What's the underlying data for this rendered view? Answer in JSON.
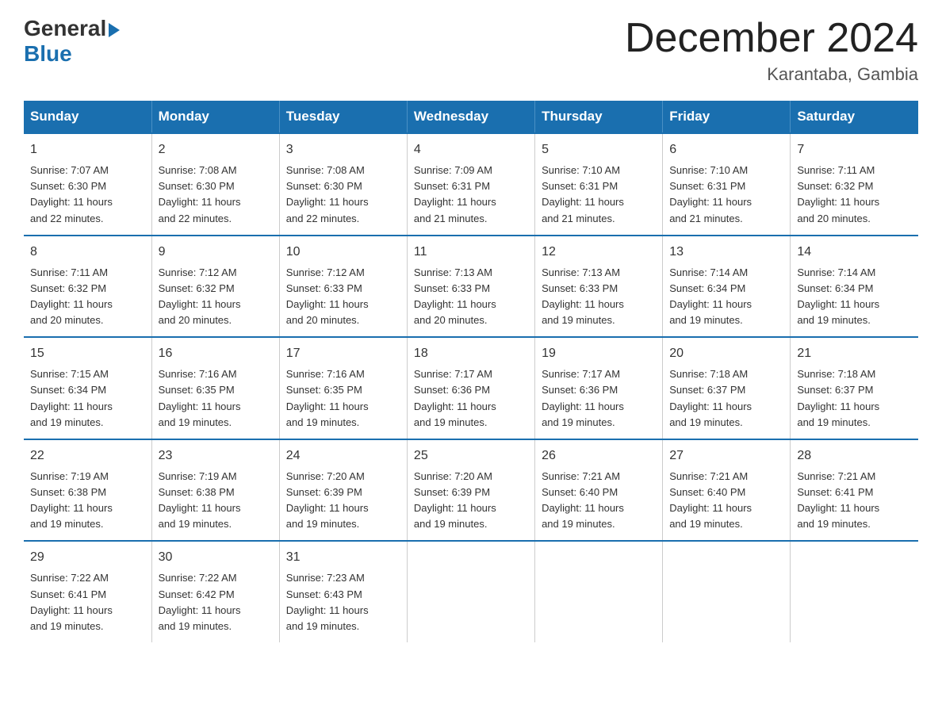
{
  "logo": {
    "general": "General",
    "blue": "Blue"
  },
  "title": {
    "month_year": "December 2024",
    "location": "Karantaba, Gambia"
  },
  "days_header": [
    "Sunday",
    "Monday",
    "Tuesday",
    "Wednesday",
    "Thursday",
    "Friday",
    "Saturday"
  ],
  "weeks": [
    [
      {
        "day": "1",
        "sunrise": "7:07 AM",
        "sunset": "6:30 PM",
        "daylight": "11 hours and 22 minutes."
      },
      {
        "day": "2",
        "sunrise": "7:08 AM",
        "sunset": "6:30 PM",
        "daylight": "11 hours and 22 minutes."
      },
      {
        "day": "3",
        "sunrise": "7:08 AM",
        "sunset": "6:30 PM",
        "daylight": "11 hours and 22 minutes."
      },
      {
        "day": "4",
        "sunrise": "7:09 AM",
        "sunset": "6:31 PM",
        "daylight": "11 hours and 21 minutes."
      },
      {
        "day": "5",
        "sunrise": "7:10 AM",
        "sunset": "6:31 PM",
        "daylight": "11 hours and 21 minutes."
      },
      {
        "day": "6",
        "sunrise": "7:10 AM",
        "sunset": "6:31 PM",
        "daylight": "11 hours and 21 minutes."
      },
      {
        "day": "7",
        "sunrise": "7:11 AM",
        "sunset": "6:32 PM",
        "daylight": "11 hours and 20 minutes."
      }
    ],
    [
      {
        "day": "8",
        "sunrise": "7:11 AM",
        "sunset": "6:32 PM",
        "daylight": "11 hours and 20 minutes."
      },
      {
        "day": "9",
        "sunrise": "7:12 AM",
        "sunset": "6:32 PM",
        "daylight": "11 hours and 20 minutes."
      },
      {
        "day": "10",
        "sunrise": "7:12 AM",
        "sunset": "6:33 PM",
        "daylight": "11 hours and 20 minutes."
      },
      {
        "day": "11",
        "sunrise": "7:13 AM",
        "sunset": "6:33 PM",
        "daylight": "11 hours and 20 minutes."
      },
      {
        "day": "12",
        "sunrise": "7:13 AM",
        "sunset": "6:33 PM",
        "daylight": "11 hours and 19 minutes."
      },
      {
        "day": "13",
        "sunrise": "7:14 AM",
        "sunset": "6:34 PM",
        "daylight": "11 hours and 19 minutes."
      },
      {
        "day": "14",
        "sunrise": "7:14 AM",
        "sunset": "6:34 PM",
        "daylight": "11 hours and 19 minutes."
      }
    ],
    [
      {
        "day": "15",
        "sunrise": "7:15 AM",
        "sunset": "6:34 PM",
        "daylight": "11 hours and 19 minutes."
      },
      {
        "day": "16",
        "sunrise": "7:16 AM",
        "sunset": "6:35 PM",
        "daylight": "11 hours and 19 minutes."
      },
      {
        "day": "17",
        "sunrise": "7:16 AM",
        "sunset": "6:35 PM",
        "daylight": "11 hours and 19 minutes."
      },
      {
        "day": "18",
        "sunrise": "7:17 AM",
        "sunset": "6:36 PM",
        "daylight": "11 hours and 19 minutes."
      },
      {
        "day": "19",
        "sunrise": "7:17 AM",
        "sunset": "6:36 PM",
        "daylight": "11 hours and 19 minutes."
      },
      {
        "day": "20",
        "sunrise": "7:18 AM",
        "sunset": "6:37 PM",
        "daylight": "11 hours and 19 minutes."
      },
      {
        "day": "21",
        "sunrise": "7:18 AM",
        "sunset": "6:37 PM",
        "daylight": "11 hours and 19 minutes."
      }
    ],
    [
      {
        "day": "22",
        "sunrise": "7:19 AM",
        "sunset": "6:38 PM",
        "daylight": "11 hours and 19 minutes."
      },
      {
        "day": "23",
        "sunrise": "7:19 AM",
        "sunset": "6:38 PM",
        "daylight": "11 hours and 19 minutes."
      },
      {
        "day": "24",
        "sunrise": "7:20 AM",
        "sunset": "6:39 PM",
        "daylight": "11 hours and 19 minutes."
      },
      {
        "day": "25",
        "sunrise": "7:20 AM",
        "sunset": "6:39 PM",
        "daylight": "11 hours and 19 minutes."
      },
      {
        "day": "26",
        "sunrise": "7:21 AM",
        "sunset": "6:40 PM",
        "daylight": "11 hours and 19 minutes."
      },
      {
        "day": "27",
        "sunrise": "7:21 AM",
        "sunset": "6:40 PM",
        "daylight": "11 hours and 19 minutes."
      },
      {
        "day": "28",
        "sunrise": "7:21 AM",
        "sunset": "6:41 PM",
        "daylight": "11 hours and 19 minutes."
      }
    ],
    [
      {
        "day": "29",
        "sunrise": "7:22 AM",
        "sunset": "6:41 PM",
        "daylight": "11 hours and 19 minutes."
      },
      {
        "day": "30",
        "sunrise": "7:22 AM",
        "sunset": "6:42 PM",
        "daylight": "11 hours and 19 minutes."
      },
      {
        "day": "31",
        "sunrise": "7:23 AM",
        "sunset": "6:43 PM",
        "daylight": "11 hours and 19 minutes."
      },
      null,
      null,
      null,
      null
    ]
  ],
  "labels": {
    "sunrise": "Sunrise: ",
    "sunset": "Sunset: ",
    "daylight": "Daylight: "
  }
}
